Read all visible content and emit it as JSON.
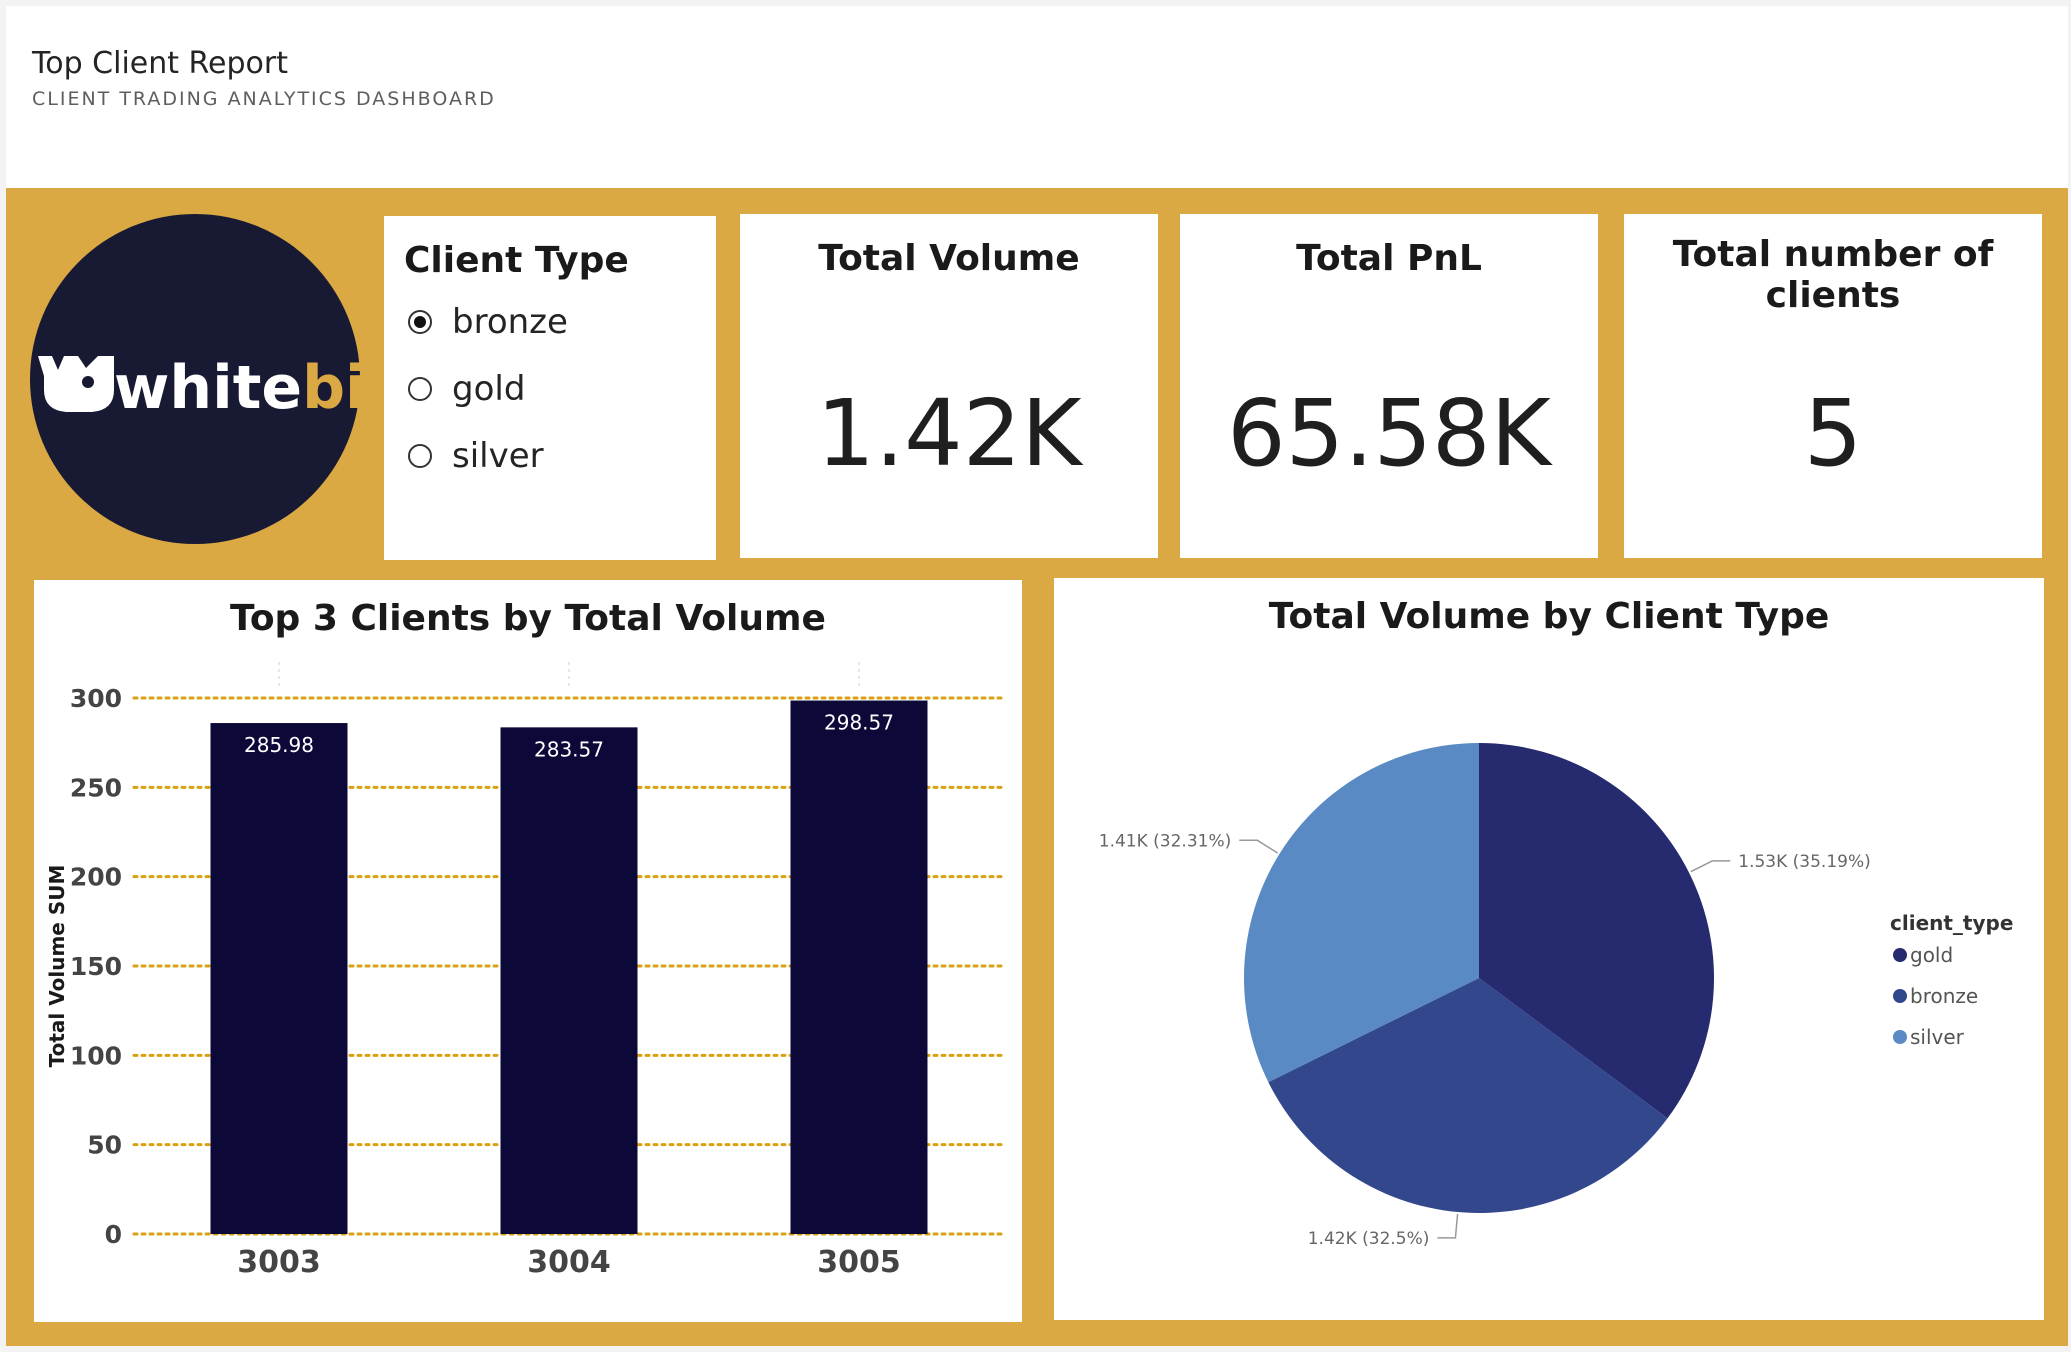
{
  "report": {
    "title": "Top Client Report",
    "subtitle": "CLIENT TRADING ANALYTICS DASHBOARD"
  },
  "logo": {
    "text_white": "white",
    "text_gold": "bit",
    "bg_color": "#181a33",
    "gold_color": "#dba944"
  },
  "slicer": {
    "title": "Client Type",
    "options": [
      {
        "label": "bronze",
        "selected": true
      },
      {
        "label": "gold",
        "selected": false
      },
      {
        "label": "silver",
        "selected": false
      }
    ]
  },
  "kpis": [
    {
      "title": "Total Volume",
      "value": "1.42K"
    },
    {
      "title": "Total PnL",
      "value": "65.58K"
    },
    {
      "title": "Total number of clients",
      "value": "5"
    }
  ],
  "colors": {
    "canvas": "#dba944",
    "bar": "#0c0838",
    "grid": "#d9a012",
    "gold": "#262a6e",
    "bronze": "#33478c",
    "silver": "#5a8ac3"
  },
  "chart_data": [
    {
      "type": "bar",
      "title": "Top 3 Clients by Total Volume",
      "xlabel": "",
      "ylabel": "Total Volume SUM",
      "categories": [
        "3003",
        "3004",
        "3005"
      ],
      "values": [
        285.98,
        283.57,
        298.57
      ],
      "data_labels": [
        "285.98",
        "283.57",
        "298.57"
      ],
      "ylim": [
        0,
        300
      ],
      "yticks": [
        "0",
        "50",
        "100",
        "150",
        "200",
        "250",
        "300"
      ],
      "grid": true
    },
    {
      "type": "pie",
      "title": "Total Volume by Client Type",
      "legend_title": "client_type",
      "legend_position": "right",
      "slices": [
        {
          "name": "gold",
          "value": 1530,
          "percent": 35.19,
          "label": "1.53K (35.19%)"
        },
        {
          "name": "bronze",
          "value": 1420,
          "percent": 32.5,
          "label": "1.42K (32.5%)"
        },
        {
          "name": "silver",
          "value": 1410,
          "percent": 32.31,
          "label": "1.41K (32.31%)"
        }
      ]
    }
  ]
}
